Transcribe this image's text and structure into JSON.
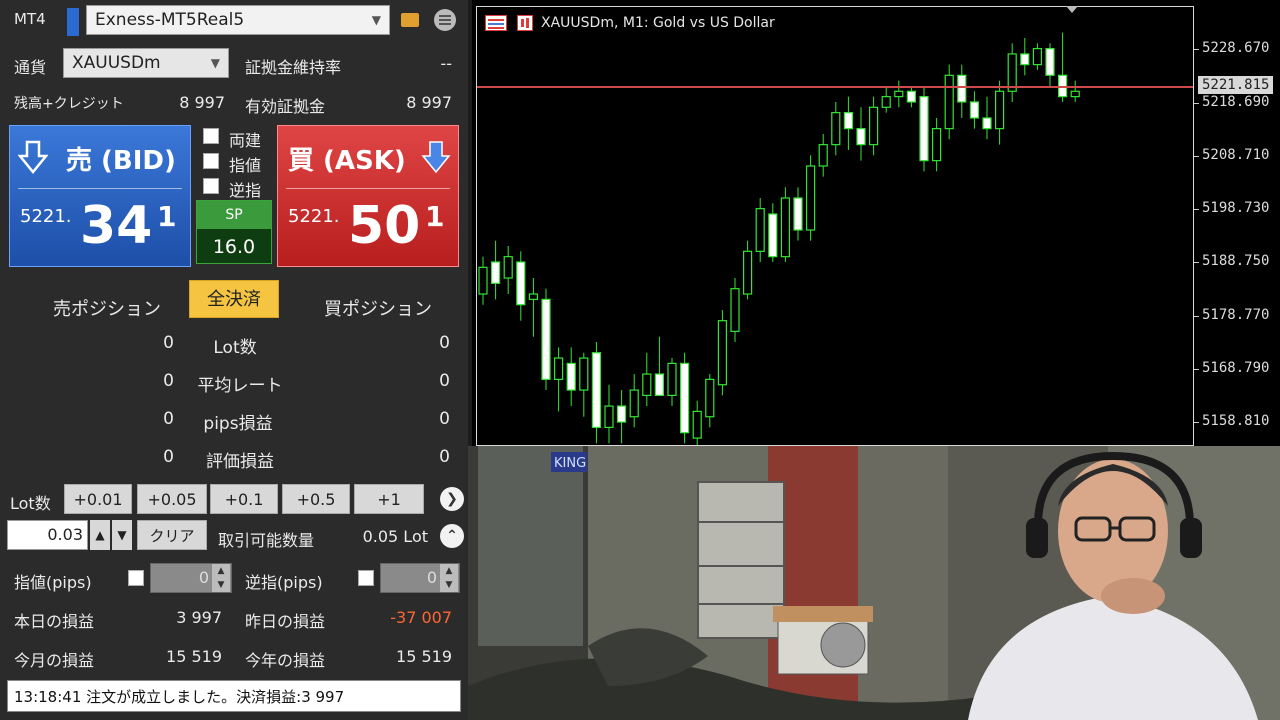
{
  "panel": {
    "app_label": "MT4",
    "account": "Exness-MT5Real5",
    "currency_label": "通貨",
    "symbol": "XAUUSDm",
    "margin_level_label": "証拠金維持率",
    "margin_level_value": "--",
    "balance_label": "残高+クレジット",
    "balance_value": "8 997",
    "effective_margin_label": "有効証拠金",
    "effective_margin_value": "8 997",
    "bid": {
      "title": "売 (BID)",
      "price_small": "5221.",
      "price_big": "34",
      "price_sup": "1"
    },
    "ask": {
      "title": "買 (ASK)",
      "price_small": "5221.",
      "price_big": "50",
      "price_sup": "1"
    },
    "checkboxes": [
      "両建",
      "指値",
      "逆指"
    ],
    "spread": {
      "label": "SP",
      "value": "16.0"
    },
    "sell_position_label": "売ポジション",
    "close_all_label": "全決済",
    "buy_position_label": "買ポジション",
    "positions": [
      {
        "label": "Lot数",
        "sell": "0",
        "buy": "0"
      },
      {
        "label": "平均レート",
        "sell": "0",
        "buy": "0"
      },
      {
        "label": "pips損益",
        "sell": "0",
        "buy": "0"
      },
      {
        "label": "評価損益",
        "sell": "0",
        "buy": "0"
      }
    ],
    "lot_label": "Lot数",
    "lot_buttons": [
      "+0.01",
      "+0.05",
      "+0.1",
      "+0.5",
      "+1"
    ],
    "lot_value": "0.03",
    "clear_label": "クリア",
    "tradable_label": "取引可能数量",
    "tradable_value": "0.05 Lot",
    "limit_label": "指値(pips)",
    "limit_value": "0",
    "stop_label": "逆指(pips)",
    "stop_value": "0",
    "today_pl_label": "本日の損益",
    "today_pl_value": "3 997",
    "yesterday_pl_label": "昨日の損益",
    "yesterday_pl_value": "-37 007",
    "month_pl_label": "今月の損益",
    "month_pl_value": "15 519",
    "year_pl_label": "今年の損益",
    "year_pl_value": "15 519",
    "status_message": "13:18:41 注文が成立しました。決済損益:3 997"
  },
  "colors": {
    "bid": "#2a63c4",
    "ask": "#cc2f2f",
    "close_all": "#f5c542",
    "loss": "#ff6633",
    "candle_outline": "#33e633",
    "price_line": "#d04a4a"
  },
  "chart_data": {
    "type": "candlestick",
    "title": "XAUUSDm, M1:  Gold vs US Dollar",
    "current_price": "5221.815",
    "y_ticks": [
      "5228.670",
      "5218.690",
      "5208.710",
      "5198.730",
      "5188.750",
      "5178.770",
      "5168.790",
      "5158.810"
    ],
    "y_tick_values": [
      5228.67,
      5218.69,
      5208.71,
      5198.73,
      5188.75,
      5178.77,
      5168.79,
      5158.81
    ],
    "ylim": [
      5154.7,
      5236.8
    ],
    "candles": [
      {
        "o": 5183,
        "h": 5190,
        "l": 5181,
        "c": 5188
      },
      {
        "o": 5189,
        "h": 5193,
        "l": 5182,
        "c": 5185
      },
      {
        "o": 5186,
        "h": 5192,
        "l": 5183,
        "c": 5190
      },
      {
        "o": 5189,
        "h": 5191,
        "l": 5178,
        "c": 5181
      },
      {
        "o": 5182,
        "h": 5186,
        "l": 5175,
        "c": 5183
      },
      {
        "o": 5182,
        "h": 5184,
        "l": 5165,
        "c": 5167
      },
      {
        "o": 5167,
        "h": 5173,
        "l": 5161,
        "c": 5171
      },
      {
        "o": 5170,
        "h": 5173,
        "l": 5162,
        "c": 5165
      },
      {
        "o": 5165,
        "h": 5172,
        "l": 5160,
        "c": 5171
      },
      {
        "o": 5172,
        "h": 5174,
        "l": 5155,
        "c": 5158
      },
      {
        "o": 5158,
        "h": 5166,
        "l": 5155,
        "c": 5162
      },
      {
        "o": 5162,
        "h": 5165,
        "l": 5155,
        "c": 5159
      },
      {
        "o": 5160,
        "h": 5168,
        "l": 5158,
        "c": 5165
      },
      {
        "o": 5164,
        "h": 5172,
        "l": 5162,
        "c": 5168
      },
      {
        "o": 5168,
        "h": 5175,
        "l": 5166,
        "c": 5164
      },
      {
        "o": 5164,
        "h": 5171,
        "l": 5162,
        "c": 5170
      },
      {
        "o": 5170,
        "h": 5172,
        "l": 5155,
        "c": 5157
      },
      {
        "o": 5156,
        "h": 5163,
        "l": 5154,
        "c": 5161
      },
      {
        "o": 5160,
        "h": 5168,
        "l": 5158,
        "c": 5167
      },
      {
        "o": 5166,
        "h": 5180,
        "l": 5164,
        "c": 5178
      },
      {
        "o": 5176,
        "h": 5186,
        "l": 5174,
        "c": 5184
      },
      {
        "o": 5183,
        "h": 5193,
        "l": 5182,
        "c": 5191
      },
      {
        "o": 5191,
        "h": 5201,
        "l": 5189,
        "c": 5199
      },
      {
        "o": 5198,
        "h": 5200,
        "l": 5189,
        "c": 5190
      },
      {
        "o": 5190,
        "h": 5203,
        "l": 5189,
        "c": 5201
      },
      {
        "o": 5201,
        "h": 5203,
        "l": 5193,
        "c": 5195
      },
      {
        "o": 5195,
        "h": 5209,
        "l": 5193,
        "c": 5207
      },
      {
        "o": 5207,
        "h": 5213,
        "l": 5205,
        "c": 5211
      },
      {
        "o": 5211,
        "h": 5219,
        "l": 5209,
        "c": 5217
      },
      {
        "o": 5217,
        "h": 5220,
        "l": 5210,
        "c": 5214
      },
      {
        "o": 5214,
        "h": 5218,
        "l": 5208,
        "c": 5211
      },
      {
        "o": 5211,
        "h": 5220,
        "l": 5209,
        "c": 5218
      },
      {
        "o": 5218,
        "h": 5222,
        "l": 5217,
        "c": 5220
      },
      {
        "o": 5220,
        "h": 5223,
        "l": 5218,
        "c": 5221
      },
      {
        "o": 5221,
        "h": 5222,
        "l": 5218,
        "c": 5219
      },
      {
        "o": 5220,
        "h": 5222,
        "l": 5206,
        "c": 5208
      },
      {
        "o": 5208,
        "h": 5216,
        "l": 5206,
        "c": 5214
      },
      {
        "o": 5214,
        "h": 5226,
        "l": 5212,
        "c": 5224
      },
      {
        "o": 5224,
        "h": 5226,
        "l": 5216,
        "c": 5219
      },
      {
        "o": 5219,
        "h": 5221,
        "l": 5214,
        "c": 5216
      },
      {
        "o": 5216,
        "h": 5220,
        "l": 5212,
        "c": 5214
      },
      {
        "o": 5214,
        "h": 5223,
        "l": 5211,
        "c": 5221
      },
      {
        "o": 5221,
        "h": 5230,
        "l": 5219,
        "c": 5228
      },
      {
        "o": 5228,
        "h": 5231,
        "l": 5224,
        "c": 5226
      },
      {
        "o": 5226,
        "h": 5230,
        "l": 5225,
        "c": 5229
      },
      {
        "o": 5229,
        "h": 5230,
        "l": 5222,
        "c": 5224
      },
      {
        "o": 5224,
        "h": 5232,
        "l": 5219,
        "c": 5220
      },
      {
        "o": 5220,
        "h": 5223,
        "l": 5219,
        "c": 5221
      }
    ]
  },
  "icons": {
    "folder": "folder-icon",
    "menu": "menu-icon",
    "bid_arrow": "arrow-down-icon",
    "ask_arrow": "arrow-down-icon"
  }
}
